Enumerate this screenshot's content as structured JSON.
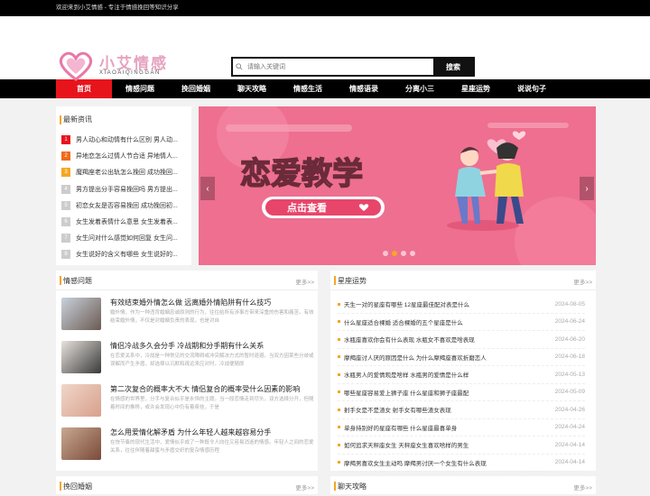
{
  "topbar": {
    "text": "欢迎来到小艾情感 - 专注于情感挽回等知识分享"
  },
  "logo": {
    "cn": "小艾情感",
    "en": "XIAOAIQINGGAN"
  },
  "search": {
    "placeholder": "请输入关键词",
    "button": "搜索"
  },
  "nav": [
    "首页",
    "情感问题",
    "挽回婚姻",
    "聊天攻略",
    "情感生活",
    "情感语录",
    "分离小三",
    "星座运势",
    "说说句子"
  ],
  "news": {
    "title": "最新资讯",
    "items": [
      {
        "n": "1",
        "t": "男人动心和动情有什么区别 男人动...",
        "c": "#e8141c"
      },
      {
        "n": "2",
        "t": "异地恋怎么过情人节合适 异地情人...",
        "c": "#f06a1a"
      },
      {
        "n": "3",
        "t": "魔羯座老公出轨怎么挽回 成功挽回...",
        "c": "#f5a623"
      },
      {
        "n": "4",
        "t": "男方提出分手容易挽回吗 男方提出...",
        "c": "#ccc"
      },
      {
        "n": "5",
        "t": "初恋女友是否容易挽回 成功挽回初...",
        "c": "#ccc"
      },
      {
        "n": "6",
        "t": "女生发着表情什么意思 女生发着表...",
        "c": "#ccc"
      },
      {
        "n": "7",
        "t": "女生问对什么感觉如何回复 女生问...",
        "c": "#ccc"
      },
      {
        "n": "8",
        "t": "女生说好的含义有哪些 女生说好的...",
        "c": "#ccc"
      }
    ]
  },
  "banner": {
    "title": "恋爱教学",
    "button": "点击查看"
  },
  "emotion": {
    "title": "情感问题",
    "more": "更多>>",
    "articles": [
      {
        "title": "有效结束婚外情怎么做 远离婚外情陷阱有什么技巧",
        "desc": "婚外情，作为一种违背婚姻忠诚原则的行为，往往给所有涉事方带来深重的伤害和痛苦。有效结束婚外情，不仅是对婚姻负责的表现，也是对自"
      },
      {
        "title": "情侣冷战多久会分手 冷战期和分手期有什么关系",
        "desc": "在恋爱关系中，冷战是一种常见的交流障碍或冲突解决方式的暂时退避。当双方因某些分歧或误解而产生矛盾，却选择以沉默和疏远来应对时，冷战便随即"
      },
      {
        "title": "第二次复合的概率大不大 情侣复合的概率受什么因素的影响",
        "desc": "在情感的世界里，分手与复合似乎是永恒的主题。当一段恋情走到尽头，双方选择分开，但随着时间的推移，或许会发现心中仍有着牵挂，于是"
      },
      {
        "title": "怎么用爱情化解矛盾 为什么年轻人越来越容易分手",
        "desc": "在快节奏的现代生活中，爱情似乎成了一种既令人向往又容易消逝的情感。年轻人之间的恋爱关系，往往伴随着甜蜜与矛盾交织的复杂情感历程"
      }
    ]
  },
  "horoscope": {
    "title": "星座运势",
    "more": "更多>>",
    "items": [
      {
        "t": "天生一对的星座有哪些 12星座最佳配对表是什么",
        "d": "2024-08-05"
      },
      {
        "t": "什么星座适合裸婚 适合裸婚的五个星座是什么",
        "d": "2024-06-24"
      },
      {
        "t": "水瓶座喜欢你会有什么表现 水瓶女不喜欢是啥表现",
        "d": "2024-06-20"
      },
      {
        "t": "摩羯座讨人厌的原因是什么 为什么摩羯座喜欢折磨恋人",
        "d": "2024-06-18"
      },
      {
        "t": "水瓶男人的爱情观是啥样 水瓶男的爱情是什么样",
        "d": "2024-05-13"
      },
      {
        "t": "哪些星座容易爱上狮子座 什么星座和狮子座最配",
        "d": "2024-05-09"
      },
      {
        "t": "射手女是不是渣女 射手女有哪些渣女表现",
        "d": "2024-04-26"
      },
      {
        "t": "单身持别好的星座有哪些 什么星座最喜单身",
        "d": "2024-04-24"
      },
      {
        "t": "如何追求天秤座女生 天秤座女生喜欢啥样的男生",
        "d": "2024-04-14"
      },
      {
        "t": "摩羯男喜欢女生主动吗 摩羯男讨厌一个女生有什么表现",
        "d": "2024-04-14"
      }
    ]
  },
  "bottom": {
    "left": "挽回婚姻",
    "right": "聊天攻略",
    "more": "更多>>"
  },
  "colors": {
    "accent": "#e8141c",
    "orange": "#f5a623",
    "banner": "#ee6f8f"
  }
}
